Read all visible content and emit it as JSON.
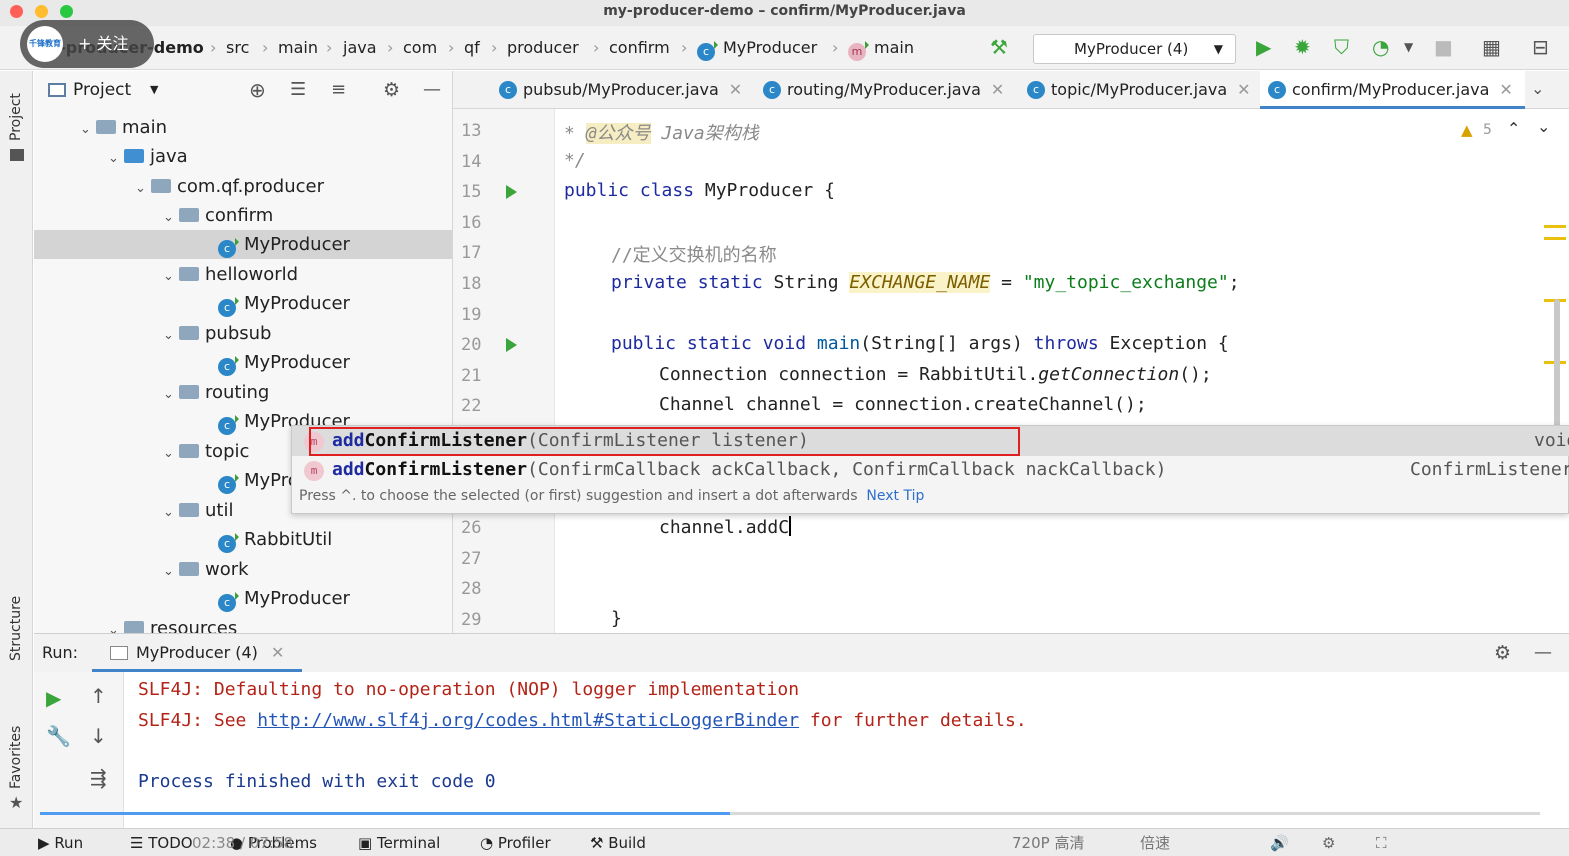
{
  "window": {
    "title": "my-producer-demo – confirm/MyProducer.java"
  },
  "overlay": {
    "follow_label": "+ 关注",
    "logo_text": "千锋教育"
  },
  "breadcrumbs": [
    "my-producer-demo",
    "src",
    "main",
    "java",
    "com",
    "qf",
    "producer",
    "confirm",
    "MyProducer",
    "main"
  ],
  "run_config": {
    "label": "MyProducer (4)"
  },
  "left_strip": {
    "project": "Project",
    "structure": "Structure",
    "favorites": "Favorites"
  },
  "project_panel": {
    "title": "Project",
    "tree": [
      {
        "label": "main",
        "type": "folder"
      },
      {
        "label": "java",
        "type": "folder"
      },
      {
        "label": "com.qf.producer",
        "type": "package"
      },
      {
        "label": "confirm",
        "type": "package"
      },
      {
        "label": "MyProducer",
        "type": "class",
        "selected": true
      },
      {
        "label": "helloworld",
        "type": "package"
      },
      {
        "label": "MyProducer",
        "type": "class"
      },
      {
        "label": "pubsub",
        "type": "package"
      },
      {
        "label": "MyProducer",
        "type": "class"
      },
      {
        "label": "routing",
        "type": "package"
      },
      {
        "label": "MyProducer",
        "type": "class"
      },
      {
        "label": "topic",
        "type": "package"
      },
      {
        "label": "MyProducer",
        "type": "class"
      },
      {
        "label": "util",
        "type": "package"
      },
      {
        "label": "RabbitUtil",
        "type": "class"
      },
      {
        "label": "work",
        "type": "package"
      },
      {
        "label": "MyProducer",
        "type": "class"
      },
      {
        "label": "resources",
        "type": "folder"
      }
    ]
  },
  "tabs": [
    {
      "label": "pubsub/MyProducer.java"
    },
    {
      "label": "routing/MyProducer.java"
    },
    {
      "label": "topic/MyProducer.java"
    },
    {
      "label": "confirm/MyProducer.java",
      "active": true
    }
  ],
  "editor": {
    "warning_count": "5",
    "line_numbers": [
      "13",
      "14",
      "15",
      "16",
      "17",
      "18",
      "19",
      "20",
      "21",
      "22",
      "26",
      "27",
      "28",
      "29"
    ],
    "lines": {
      "l13_a": "* ",
      "l13_tag": "@公众号",
      "l13_b": " Java架构栈",
      "l14": "*/",
      "l15_kw": "public class",
      "l15_rest": " MyProducer {",
      "l17": "//定义交换机的名称",
      "l18_kw": "private static",
      "l18_type": " String ",
      "l18_field": "EXCHANGE_NAME",
      "l18_eq": " = ",
      "l18_str": "\"my_topic_exchange\"",
      "l18_end": ";",
      "l20_kw": "public static void",
      "l20_fn": " main",
      "l20_mid": "(String[] args) ",
      "l20_kw2": "throws",
      "l20_end": " Exception {",
      "l21_a": "Connection connection = RabbitUtil.",
      "l21_fn": "getConnection",
      "l21_b": "();",
      "l22": "Channel channel = connection.createChannel();",
      "l26": "channel.addC",
      "l29": "}"
    }
  },
  "completion_popup": {
    "items": [
      {
        "icon": "m",
        "name_match": "add",
        "name_rest": "ConfirmListener",
        "params": "(ConfirmListener listener)",
        "return_type": "void"
      },
      {
        "icon": "m",
        "name_match": "add",
        "name_rest": "ConfirmListener",
        "params": "(ConfirmCallback ackCallback, ConfirmCallback nackCallback)",
        "return_type": "ConfirmListener"
      }
    ],
    "hint": "Press ^. to choose the selected (or first) suggestion and insert a dot afterwards",
    "hint_link": "Next Tip"
  },
  "run_panel": {
    "label": "Run:",
    "tab": "MyProducer (4)",
    "output": [
      {
        "text": "SLF4J: Defaulting to no-operation (NOP) logger implementation",
        "color": "#b42318"
      },
      {
        "prefix": "SLF4J: See ",
        "link": "http://www.slf4j.org/codes.html#StaticLoggerBinder",
        "suffix": " for further details.",
        "color": "#b42318"
      },
      {
        "text": "Process finished with exit code 0",
        "color": "#1a3a8f"
      }
    ]
  },
  "bottom_tools": [
    "Run",
    "TODO",
    "Problems",
    "Terminal",
    "Profiler",
    "Build"
  ],
  "video": {
    "time": "02:38 / 07:58",
    "quality": "720P 高清",
    "speed": "倍速",
    "progress": 0.46
  },
  "colors": {
    "accent": "#4083c9",
    "highlight_box": "#e02020",
    "run_green": "#3aa53a"
  }
}
